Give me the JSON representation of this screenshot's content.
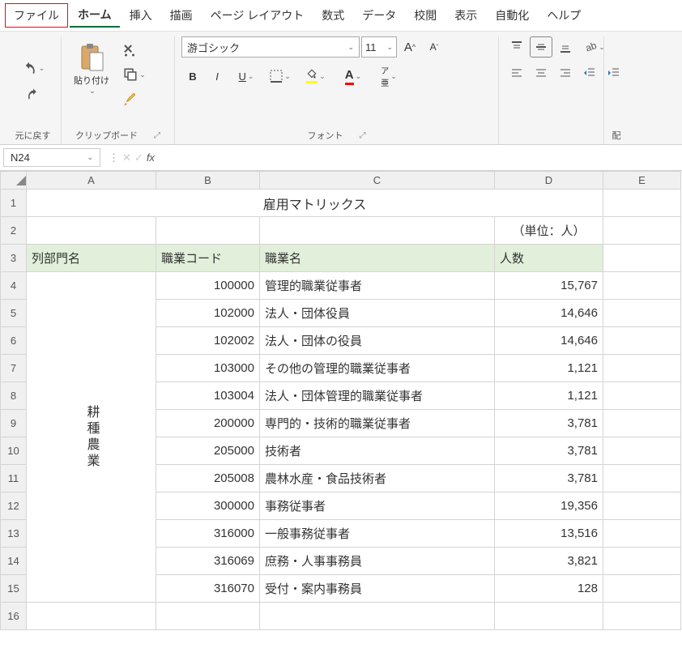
{
  "menu": {
    "file": "ファイル",
    "home": "ホーム",
    "insert": "挿入",
    "draw": "描画",
    "pagelayout": "ページ レイアウト",
    "formulas": "数式",
    "data": "データ",
    "review": "校閲",
    "view": "表示",
    "automate": "自動化",
    "help": "ヘルプ"
  },
  "ribbon": {
    "undo_group": "元に戻す",
    "clipboard_group": "クリップボード",
    "paste_label": "貼り付け",
    "font_group": "フォント",
    "font_name": "游ゴシック",
    "font_size": "11",
    "align_right_label": "配"
  },
  "namebox": "N24",
  "sheet": {
    "title": "雇用マトリックス",
    "unit": "（単位：人）",
    "headers": {
      "a": "列部門名",
      "b": "職業コード",
      "c": "職業名",
      "d": "人数"
    },
    "deptA": "耕種農業",
    "rows": [
      {
        "code": "100000",
        "name": "管理的職業従事者",
        "count": "15,767"
      },
      {
        "code": "102000",
        "name": "法人・団体役員",
        "count": "14,646"
      },
      {
        "code": "102002",
        "name": "法人・団体の役員",
        "count": "14,646"
      },
      {
        "code": "103000",
        "name": "その他の管理的職業従事者",
        "count": "1,121"
      },
      {
        "code": "103004",
        "name": "法人・団体管理的職業従事者",
        "count": "1,121"
      },
      {
        "code": "200000",
        "name": "専門的・技術的職業従事者",
        "count": "3,781"
      },
      {
        "code": "205000",
        "name": "技術者",
        "count": "3,781"
      },
      {
        "code": "205008",
        "name": "農林水産・食品技術者",
        "count": "3,781"
      },
      {
        "code": "300000",
        "name": "事務従事者",
        "count": "19,356"
      },
      {
        "code": "316000",
        "name": "一般事務従事者",
        "count": "13,516"
      },
      {
        "code": "316069",
        "name": "庶務・人事事務員",
        "count": "3,821"
      },
      {
        "code": "316070",
        "name": "受付・案内事務員",
        "count": "128"
      }
    ],
    "cols": [
      "A",
      "B",
      "C",
      "D",
      "E"
    ],
    "rownums": [
      "1",
      "2",
      "3",
      "4",
      "5",
      "6",
      "7",
      "8",
      "9",
      "10",
      "11",
      "12",
      "13",
      "14",
      "15",
      "16"
    ]
  }
}
